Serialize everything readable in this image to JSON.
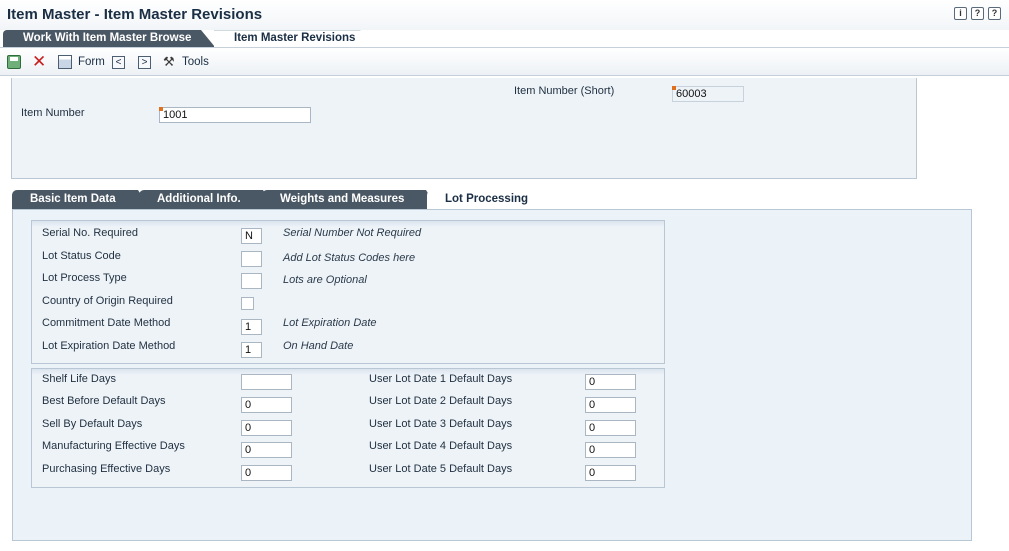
{
  "window": {
    "title": "Item Master - Item Master Revisions"
  },
  "title_icons": {
    "info": "i",
    "help": "?",
    "context_help": "?"
  },
  "app_tabs": [
    {
      "label": "Work With Item Master Browse"
    },
    {
      "label": "Item Master Revisions"
    }
  ],
  "toolbar": {
    "form_label": "Form",
    "tools_label": "Tools",
    "prev": "<",
    "next": ">"
  },
  "header": {
    "item_number_short_label": "Item Number (Short)",
    "item_number_short_value": "60003",
    "item_number_label": "Item Number",
    "item_number_value": "1001"
  },
  "form_tabs": [
    {
      "label": "Basic Item Data"
    },
    {
      "label": "Additional Info."
    },
    {
      "label": "Weights and Measures"
    },
    {
      "label": "Lot Processing"
    }
  ],
  "lot_fields": [
    {
      "label": "Serial No. Required",
      "value": "N",
      "desc": "Serial Number Not Required"
    },
    {
      "label": "Lot Status Code",
      "value": "",
      "desc": "Add Lot Status Codes here"
    },
    {
      "label": "Lot Process Type",
      "value": "",
      "desc": "Lots are Optional"
    },
    {
      "label": "Country of Origin Required",
      "checked": false,
      "desc": ""
    },
    {
      "label": "Commitment Date Method",
      "value": "1",
      "desc": "Lot Expiration Date"
    },
    {
      "label": "Lot Expiration Date Method",
      "value": "1",
      "desc": "On Hand Date"
    }
  ],
  "days_left": [
    {
      "label": "Shelf Life Days",
      "value": ""
    },
    {
      "label": "Best Before Default Days",
      "value": "0"
    },
    {
      "label": "Sell By Default Days",
      "value": "0"
    },
    {
      "label": "Manufacturing Effective Days",
      "value": "0"
    },
    {
      "label": "Purchasing Effective Days",
      "value": "0"
    }
  ],
  "days_right": [
    {
      "label": "User Lot Date 1 Default Days",
      "value": "0"
    },
    {
      "label": "User Lot Date 2 Default Days",
      "value": "0"
    },
    {
      "label": "User Lot Date 3 Default Days",
      "value": "0"
    },
    {
      "label": "User Lot Date 4 Default Days",
      "value": "0"
    },
    {
      "label": "User Lot Date 5 Default Days",
      "value": "0"
    }
  ],
  "colors": {
    "tab_dark": "#4a5764",
    "panel_bg": "#eef3f8",
    "border": "#b9c6d4",
    "required_marker": "#e0701e"
  }
}
